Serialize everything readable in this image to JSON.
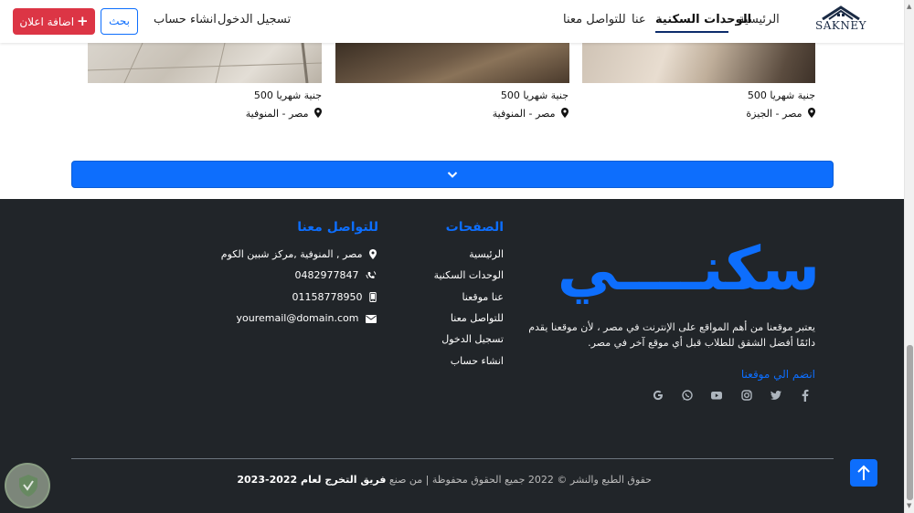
{
  "navbar": {
    "brand": "SAKNEY",
    "items": [
      {
        "label": "الرئيسية"
      },
      {
        "label": "الوحدات السكنية"
      },
      {
        "label": "عنا"
      },
      {
        "label": "للتواصل معنا"
      }
    ],
    "login": "تسجيل الدخول",
    "register": "انشاء حساب",
    "search_label": "بحث",
    "add_ad_label": "اضافة اعلان"
  },
  "cards": [
    {
      "price": "500 جنية شهريا",
      "location": "مصر - الجيزة"
    },
    {
      "price": "500 جنية شهريا",
      "location": "مصر - المنوفية"
    },
    {
      "price": "500 جنية شهريا",
      "location": "مصر - المنوفية"
    }
  ],
  "footer": {
    "logo": "سكنــــي",
    "about": "يعتبر موقعنا من أهم المواقع على الإنترنت في مصر ، لأن موقعنا يقدم دائمًا أفضل الشقق للطلاب قبل أي موقع آخر في مصر.",
    "join_label": "انضم الي موقعنا",
    "social_icons": [
      "facebook-icon",
      "twitter-icon",
      "instagram-icon",
      "youtube-icon",
      "whatsapp-icon",
      "google-icon"
    ],
    "pages_title": "الصفحات",
    "pages_links": [
      "الرئيسية",
      "الوحدات السكنية",
      "عنا موقعنا",
      "للتواصل معنا",
      "تسجيل الدخول",
      "انشاء حساب"
    ],
    "contact_title": "للتواصل معنا",
    "contact": {
      "address": "مصر , المنوفية ,مركز شبين الكوم",
      "phone": "0482977847",
      "mobile": "01158778950",
      "email": "youremail@domain.com"
    },
    "copyright_prefix": "حقوق الطبع والنشر © 2022 جميع الحقوق محفوظة | من صنع",
    "copyright_team": "فريق التخرج لعام 2022-2023"
  },
  "colors": {
    "primary": "#0d6efd",
    "danger": "#dc3545",
    "footer_bg": "#212529"
  }
}
